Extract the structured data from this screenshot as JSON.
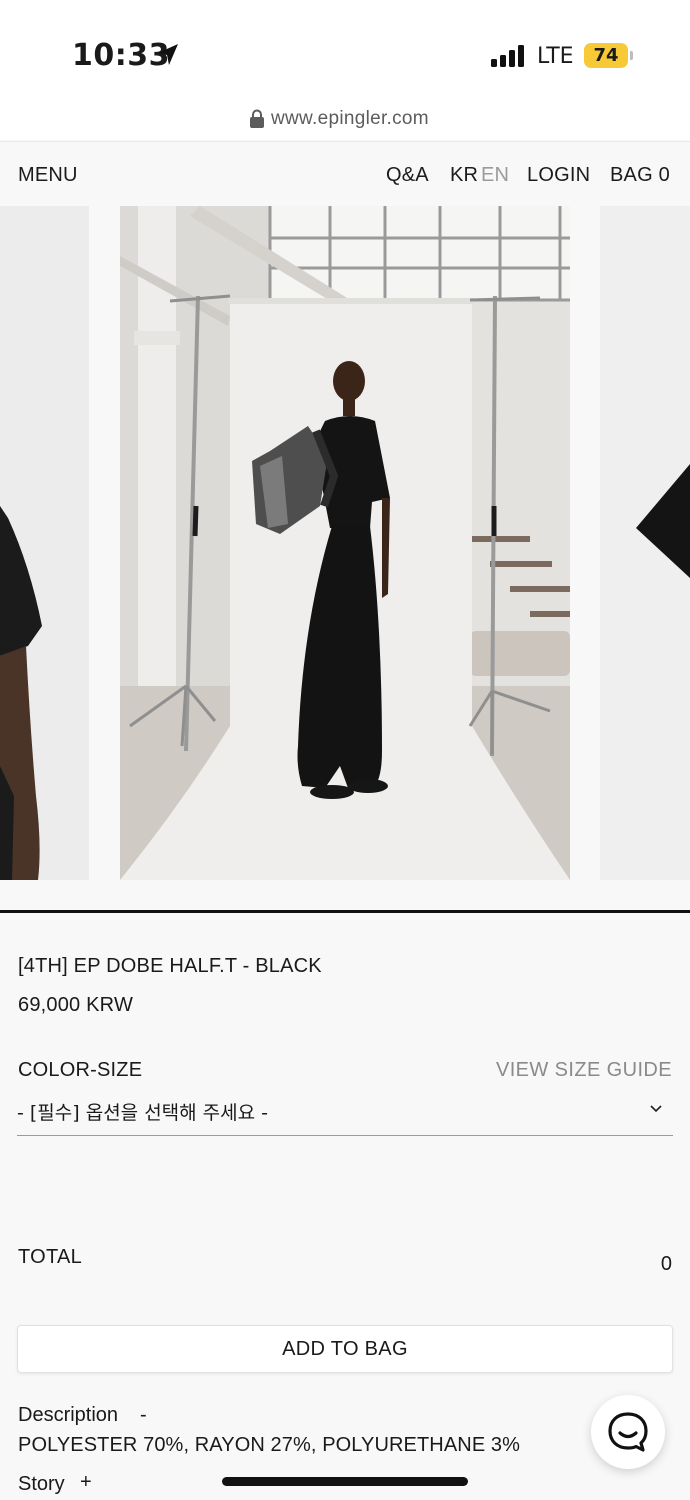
{
  "status_bar": {
    "time": "10:33",
    "network": "LTE",
    "battery": "74",
    "icons": [
      "location-arrow-icon",
      "signal-bars-icon",
      "battery-icon"
    ],
    "battery_color": "#f7c935"
  },
  "browser": {
    "url": "www.epingler.com",
    "icon": "lock-icon"
  },
  "nav": {
    "menu": "MENU",
    "qa": "Q&A",
    "lang_kr": "KR",
    "lang_en": "EN",
    "login": "LOGIN",
    "bag": "BAG 0"
  },
  "product": {
    "name": "[4TH] EP DOBE HALF.T - BLACK",
    "price": "69,000 KRW",
    "option_label": "COLOR-SIZE",
    "size_guide": "VIEW SIZE GUIDE",
    "option_placeholder": "- [필수] 옵션을 선택해 주세요 -",
    "total_label": "TOTAL",
    "total_value": "0",
    "add_to_bag": "ADD TO BAG"
  },
  "details": {
    "description_label": "Description",
    "description_toggle": "-",
    "material": "POLYESTER 70%, RAYON 27%, POLYURETHANE 3%",
    "story_label": "Story",
    "story_toggle": "+"
  },
  "colors": {
    "background": "#f8f8f8",
    "text": "#1a1a1a",
    "muted": "#8a8a8a",
    "divider": "#111111"
  }
}
